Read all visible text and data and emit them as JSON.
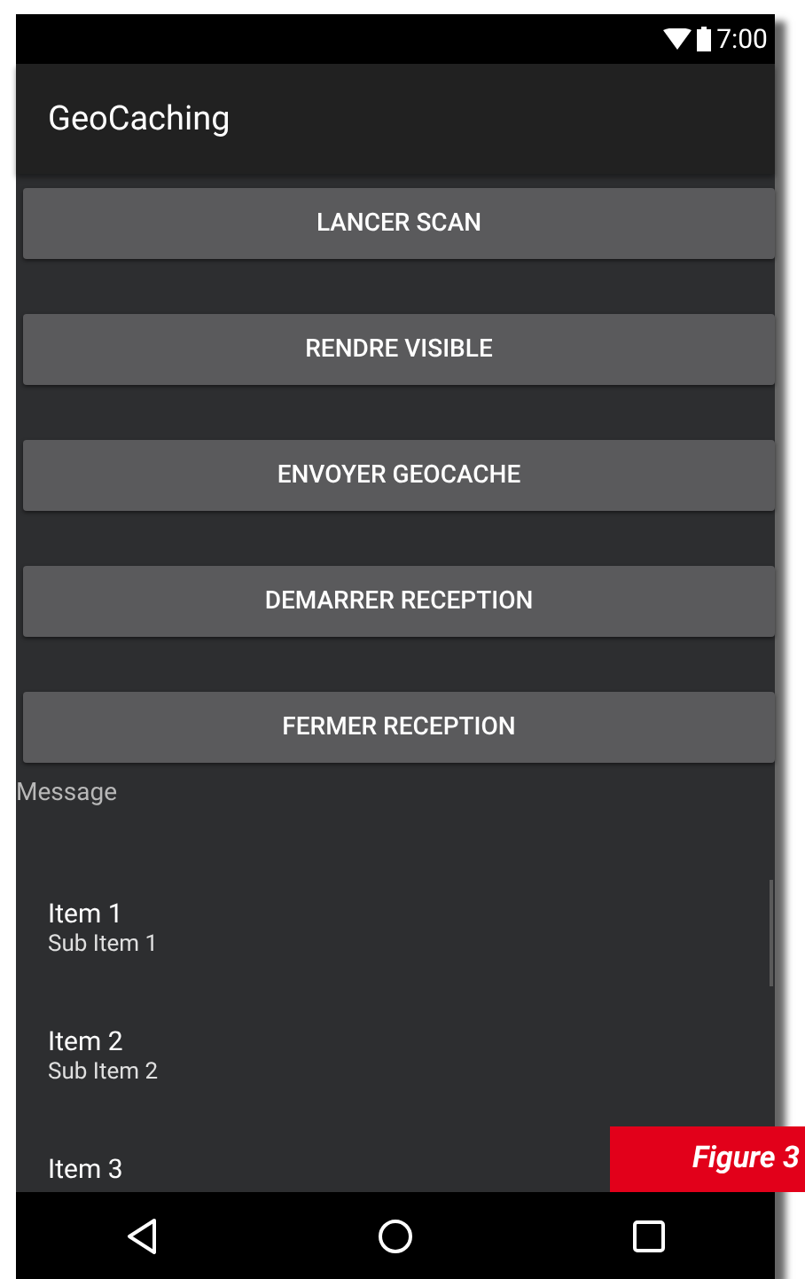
{
  "status_bar": {
    "time": "7:00"
  },
  "app_bar": {
    "title": "GeoCaching"
  },
  "buttons": [
    "LANCER SCAN",
    "RENDRE VISIBLE",
    "ENVOYER GEOCACHE",
    "DEMARRER RECEPTION",
    "FERMER RECEPTION"
  ],
  "message_label": "Message",
  "list": [
    {
      "title": "Item 1",
      "subtitle": "Sub Item 1"
    },
    {
      "title": "Item 2",
      "subtitle": "Sub Item 2"
    },
    {
      "title": "Item 3"
    }
  ],
  "caption": "Figure 3"
}
